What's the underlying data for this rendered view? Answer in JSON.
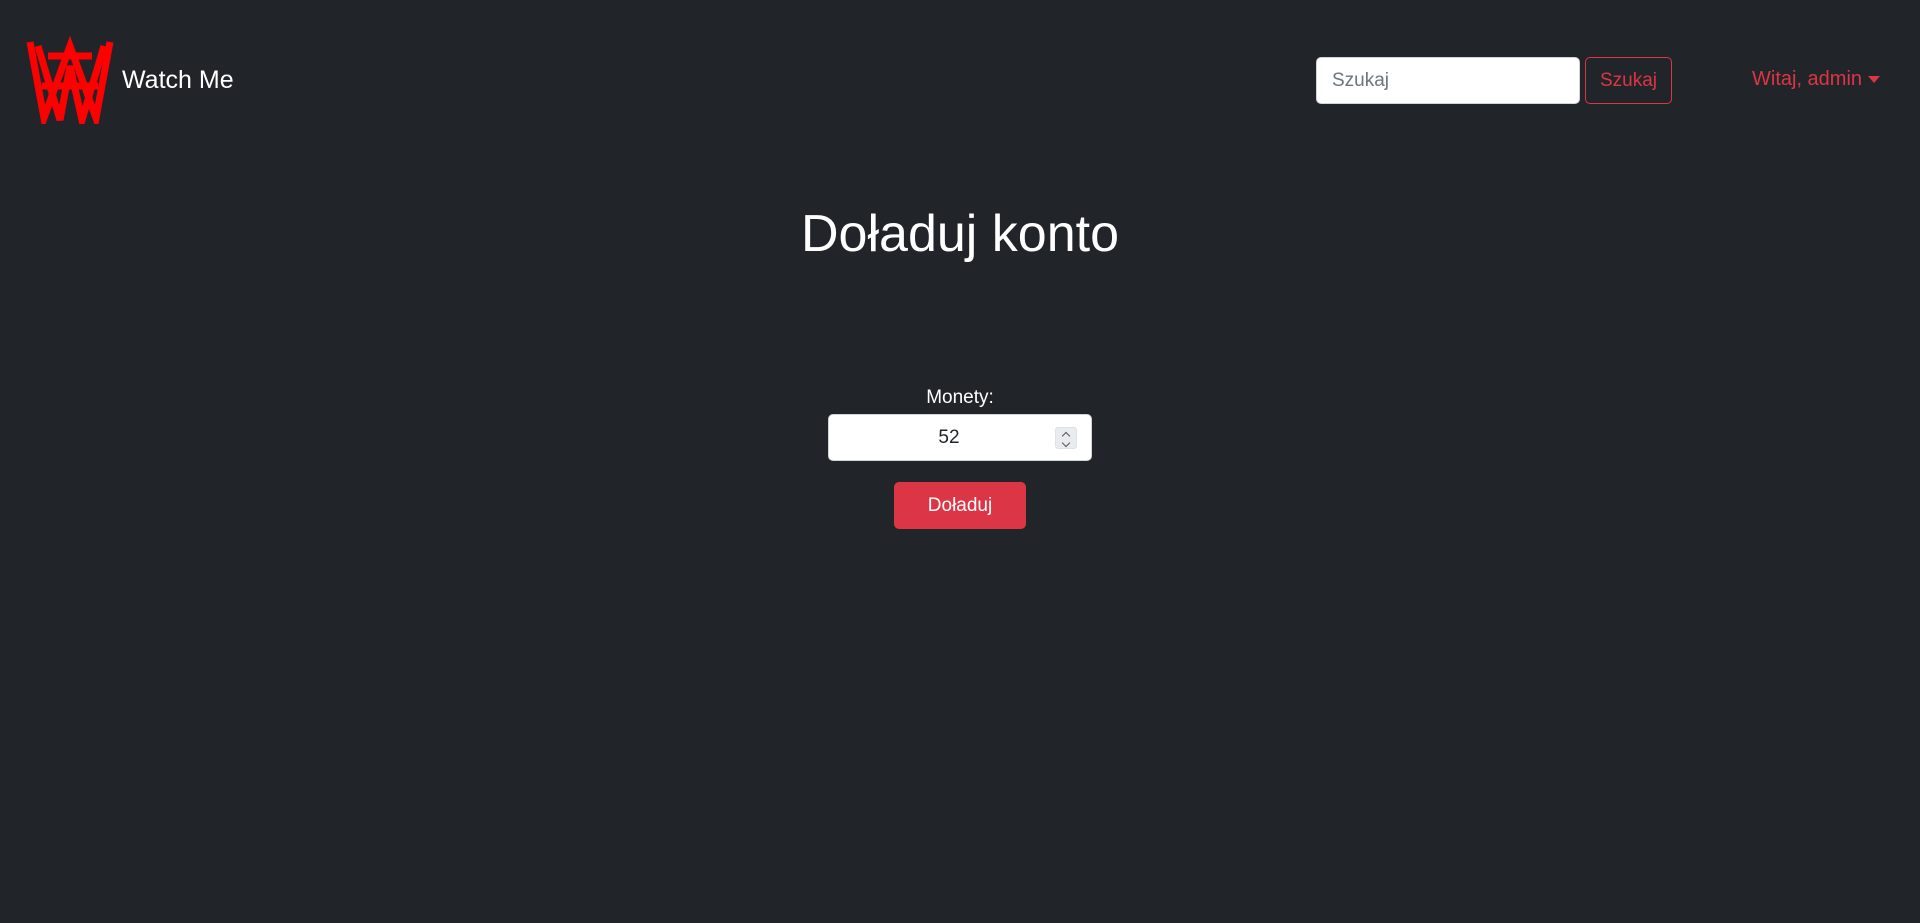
{
  "brand": {
    "name": "Watch Me",
    "logo_icon": "watchme-w-logo-icon",
    "logo_color": "#ff0000"
  },
  "search": {
    "placeholder": "Szukaj",
    "value": "",
    "button_label": "Szukaj"
  },
  "user_menu": {
    "label": "Witaj, admin",
    "icon": "caret-down-icon"
  },
  "page": {
    "title": "Doładuj konto"
  },
  "topup_form": {
    "coins_label": "Monety:",
    "coins_value": "52",
    "submit_label": "Doładuj"
  },
  "colors": {
    "background": "#212529",
    "accent": "#dc3545",
    "text": "#ffffff"
  }
}
